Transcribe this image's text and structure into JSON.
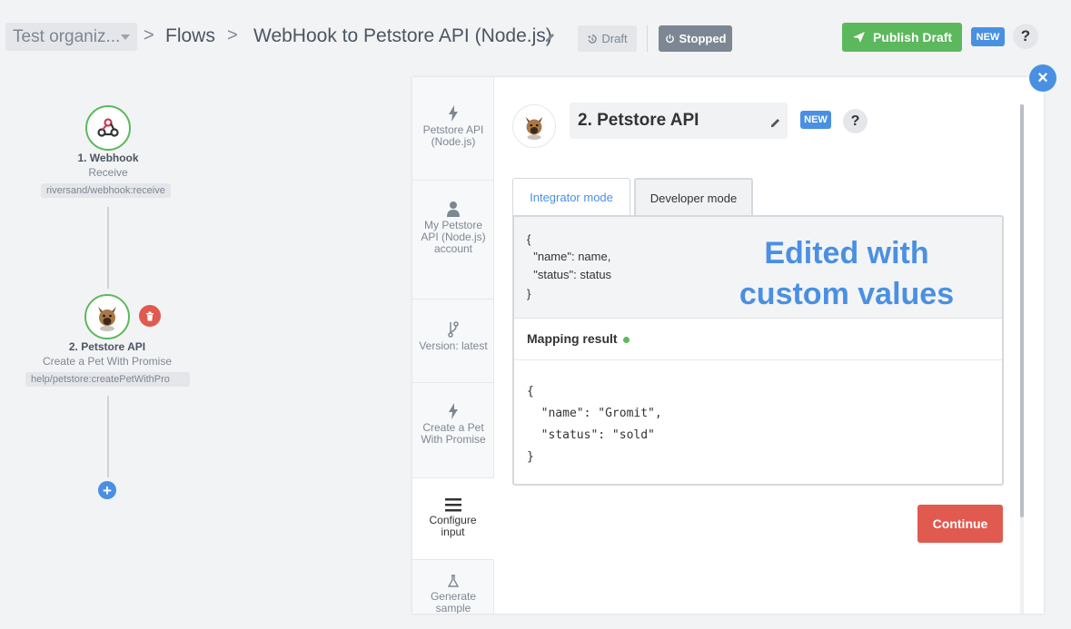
{
  "topbar": {
    "org_name": "Test organiz...",
    "breadcrumb_flows": "Flows",
    "flow_name": "WebHook to Petstore API (Node.js)",
    "draft_label": "Draft",
    "stopped_label": "Stopped",
    "publish_label": "Publish Draft",
    "new_badge": "NEW",
    "help_label": "?"
  },
  "flow": {
    "nodes": [
      {
        "title": "1. Webhook",
        "subtitle": "Receive",
        "path": "riversand/webhook:receive"
      },
      {
        "title": "2. Petstore API",
        "subtitle": "Create a Pet With Promise",
        "path": "help/petstore:createPetWithPro"
      }
    ],
    "add_label": "+"
  },
  "panel": {
    "steps": [
      {
        "icon": "bolt-icon",
        "label": "Petstore API (Node.js)"
      },
      {
        "icon": "user-icon",
        "label": "My Petstore API (Node.js) account"
      },
      {
        "icon": "branch-icon",
        "label": "Version: latest"
      },
      {
        "icon": "bolt-icon",
        "label": "Create a Pet With Promise"
      },
      {
        "icon": "menu-icon",
        "label": "Configure input"
      },
      {
        "icon": "flask-icon",
        "label": "Generate sample"
      }
    ],
    "step_name": "2. Petstore API",
    "new_badge": "NEW",
    "help_label": "?",
    "tabs": {
      "integrator": "Integrator mode",
      "developer": "Developer mode"
    },
    "input_code": [
      "{",
      "  \"name\": name,",
      "  \"status\": status",
      "}"
    ],
    "callout": "Edited with custom values",
    "mapping_result_label": "Mapping result",
    "output_code": [
      "{",
      "  \"name\": \"Gromit\",",
      "  \"status\": \"sold\"",
      "}"
    ],
    "continue_label": "Continue",
    "close_label": "×"
  },
  "colors": {
    "accent_blue": "#4a90e2",
    "success_green": "#5cb85c",
    "danger_red": "#e05a4f",
    "muted_gray": "#7d8794"
  }
}
